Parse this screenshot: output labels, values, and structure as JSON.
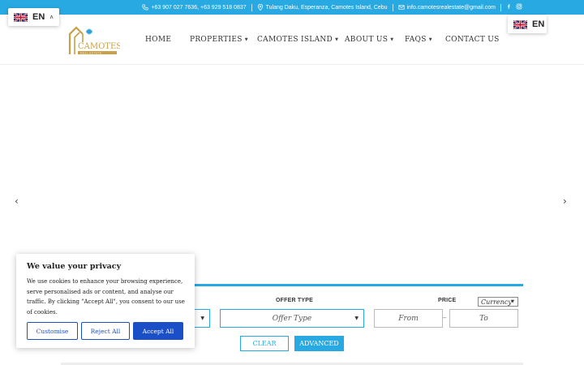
{
  "topbar": {
    "phones": "+63 907 027 7636, +63 929 518 0837",
    "address": "Tulang Daku, Esperanza, Camotes Island, Cebu",
    "email": "info.camotesrealestate@gmail.com"
  },
  "brand": {
    "logo_word": "CAMOTES",
    "logo_tagline": "REAL ESTATE"
  },
  "nav": {
    "items": [
      {
        "label": "HOME",
        "has_dropdown": false
      },
      {
        "label": "PROPERTIES",
        "has_dropdown": true
      },
      {
        "label": "CAMOTES ISLAND",
        "has_dropdown": true
      },
      {
        "label": "ABOUT US",
        "has_dropdown": true
      },
      {
        "label": "FAQS",
        "has_dropdown": true
      },
      {
        "label": "CONTACT US",
        "has_dropdown": false
      }
    ]
  },
  "language": {
    "code": "EN"
  },
  "search": {
    "offer_type_label": "OFFER TYPE",
    "offer_type_value": "Offer Type",
    "price_label": "PRICE",
    "currency_value": "Currency",
    "price_from_placeholder": "From",
    "price_to_placeholder": "To",
    "range_separator": "–",
    "clear_label": "CLEAR",
    "advanced_label": "ADVANCED"
  },
  "cookie": {
    "title": "We value your privacy",
    "body": "We use cookies to enhance your browsing experience, serve personalised ads or content, and analyse our traffic. By clicking \"Accept All\", you consent to our use of cookies.",
    "customise_label": "Customise",
    "reject_label": "Reject All",
    "accept_label": "Accept All"
  },
  "colors": {
    "accent": "#29a9e1",
    "cookie_button": "#1b4fc8",
    "logo_gold": "#c8a046"
  }
}
